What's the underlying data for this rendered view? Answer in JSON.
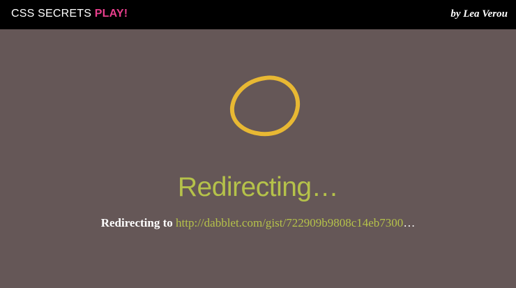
{
  "header": {
    "brand_text": "CSS SECRETS",
    "brand_accent": "PLAY!",
    "author": "by Lea Verou"
  },
  "spinner": {
    "icon": "loading-ring-icon",
    "color": "#e8b833"
  },
  "main": {
    "heading": "Redirecting…",
    "message_lead": "Redirecting to",
    "url": "http://dabblet.com/gist/722909b9808c14eb7300",
    "message_tail": "…"
  },
  "colors": {
    "background": "#655757",
    "topbar": "#000000",
    "accent_pink": "#e83e8c",
    "accent_green": "#b5c24a"
  }
}
